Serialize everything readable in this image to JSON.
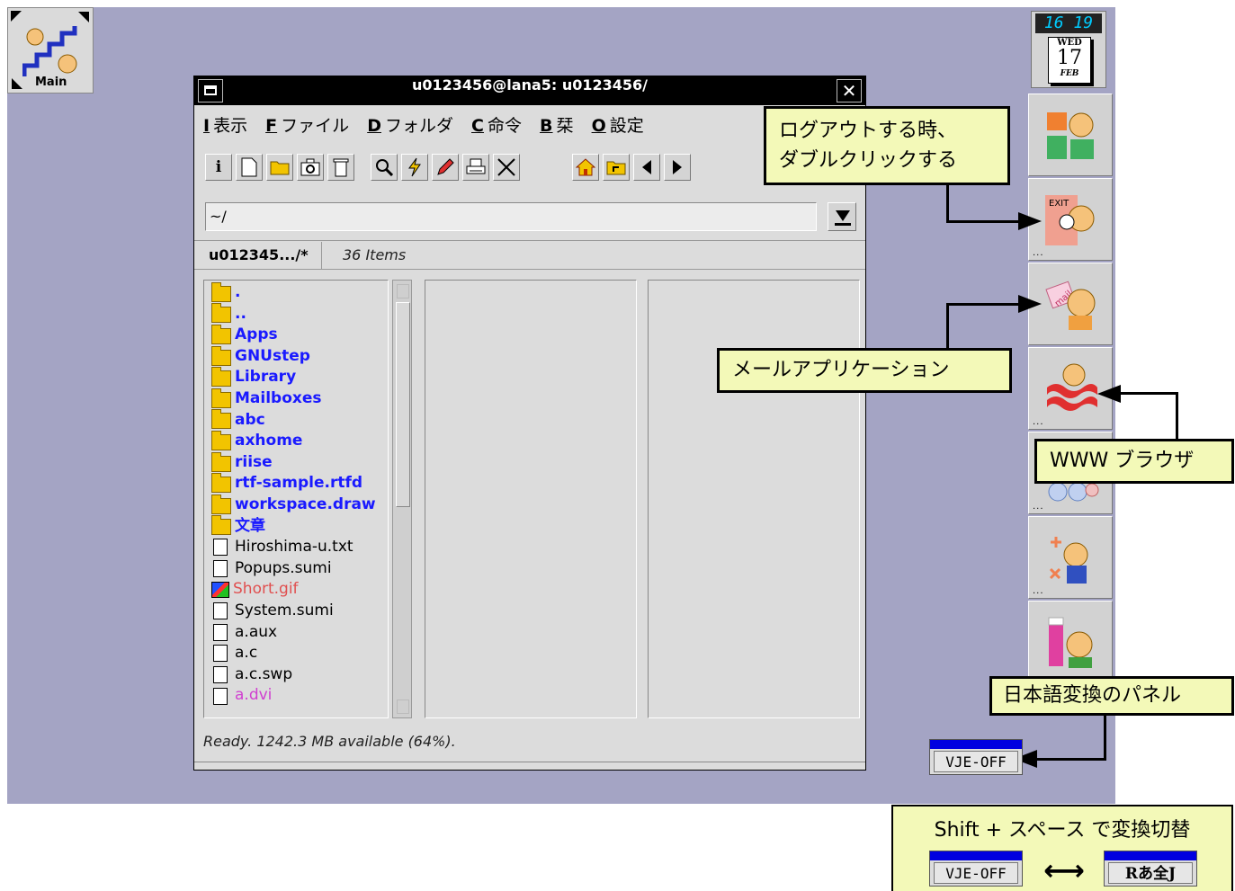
{
  "desktop": {
    "main_icon_label": "Main"
  },
  "window": {
    "title": "u0123456@lana5: u0123456/",
    "close_glyph": "✕",
    "menus": [
      {
        "key": "I",
        "label": "表示"
      },
      {
        "key": "F",
        "label": "ファイル"
      },
      {
        "key": "D",
        "label": "フォルダ"
      },
      {
        "key": "C",
        "label": "命令"
      },
      {
        "key": "B",
        "label": "栞"
      },
      {
        "key": "O",
        "label": "設定"
      }
    ],
    "toolbar_icons": [
      "info-icon",
      "new-file-icon",
      "new-folder-icon",
      "camera-icon",
      "trash-icon",
      "find-icon",
      "lightning-icon",
      "pencil-icon",
      "print-icon",
      "cut-icon",
      "home-icon",
      "parent-folder-icon",
      "back-icon",
      "forward-icon"
    ],
    "path_value": "~/",
    "crumb": "u012345.../*",
    "items_count": "36 Items",
    "files": [
      {
        "name": ".",
        "type": "folder"
      },
      {
        "name": "..",
        "type": "folder"
      },
      {
        "name": "Apps",
        "type": "folder"
      },
      {
        "name": "GNUstep",
        "type": "folder"
      },
      {
        "name": "Library",
        "type": "folder"
      },
      {
        "name": "Mailboxes",
        "type": "folder"
      },
      {
        "name": "abc",
        "type": "folder"
      },
      {
        "name": "axhome",
        "type": "folder"
      },
      {
        "name": "riise",
        "type": "folder"
      },
      {
        "name": "rtf-sample.rtfd",
        "type": "folder"
      },
      {
        "name": "workspace.draw",
        "type": "folder"
      },
      {
        "name": "文章",
        "type": "folder"
      },
      {
        "name": "Hiroshima-u.txt",
        "type": "text"
      },
      {
        "name": "Popups.sumi",
        "type": "file"
      },
      {
        "name": "Short.gif",
        "type": "image"
      },
      {
        "name": "System.sumi",
        "type": "file"
      },
      {
        "name": "a.aux",
        "type": "file"
      },
      {
        "name": "a.c",
        "type": "cfile"
      },
      {
        "name": "a.c.swp",
        "type": "file"
      },
      {
        "name": "a.dvi",
        "type": "dvi"
      }
    ],
    "status": "Ready.  1242.3 MB available (64%)."
  },
  "dock": {
    "clock_time": "16 19",
    "clock_dow": "WED",
    "clock_day": "17",
    "clock_month": "FEB",
    "exit_label": "EXIT",
    "mail_label": "mail",
    "dots": "...",
    "icons": [
      "workspace-icon",
      "exit-icon",
      "mail-icon",
      "www-browser-icon",
      "japanese-input-icon",
      "calculator-icon",
      "paint-icon"
    ]
  },
  "callouts": {
    "logout": "ログアウトする時、\nダブルクリックする",
    "mail": "メールアプリケーション",
    "www": "WWW ブラウザ",
    "ime_panel": "日本語変換のパネル",
    "legend_title": "Shift + スペース で変換切替"
  },
  "vje": {
    "off_label": "VJE-OFF",
    "on_label": "Rあ全J",
    "swap_glyph": "⟷"
  },
  "colors": {
    "desktop": "#a4a4c4",
    "callout_bg": "#f3f9b8",
    "dir_text": "#1a1aff",
    "vje_bar": "#0000e0"
  }
}
